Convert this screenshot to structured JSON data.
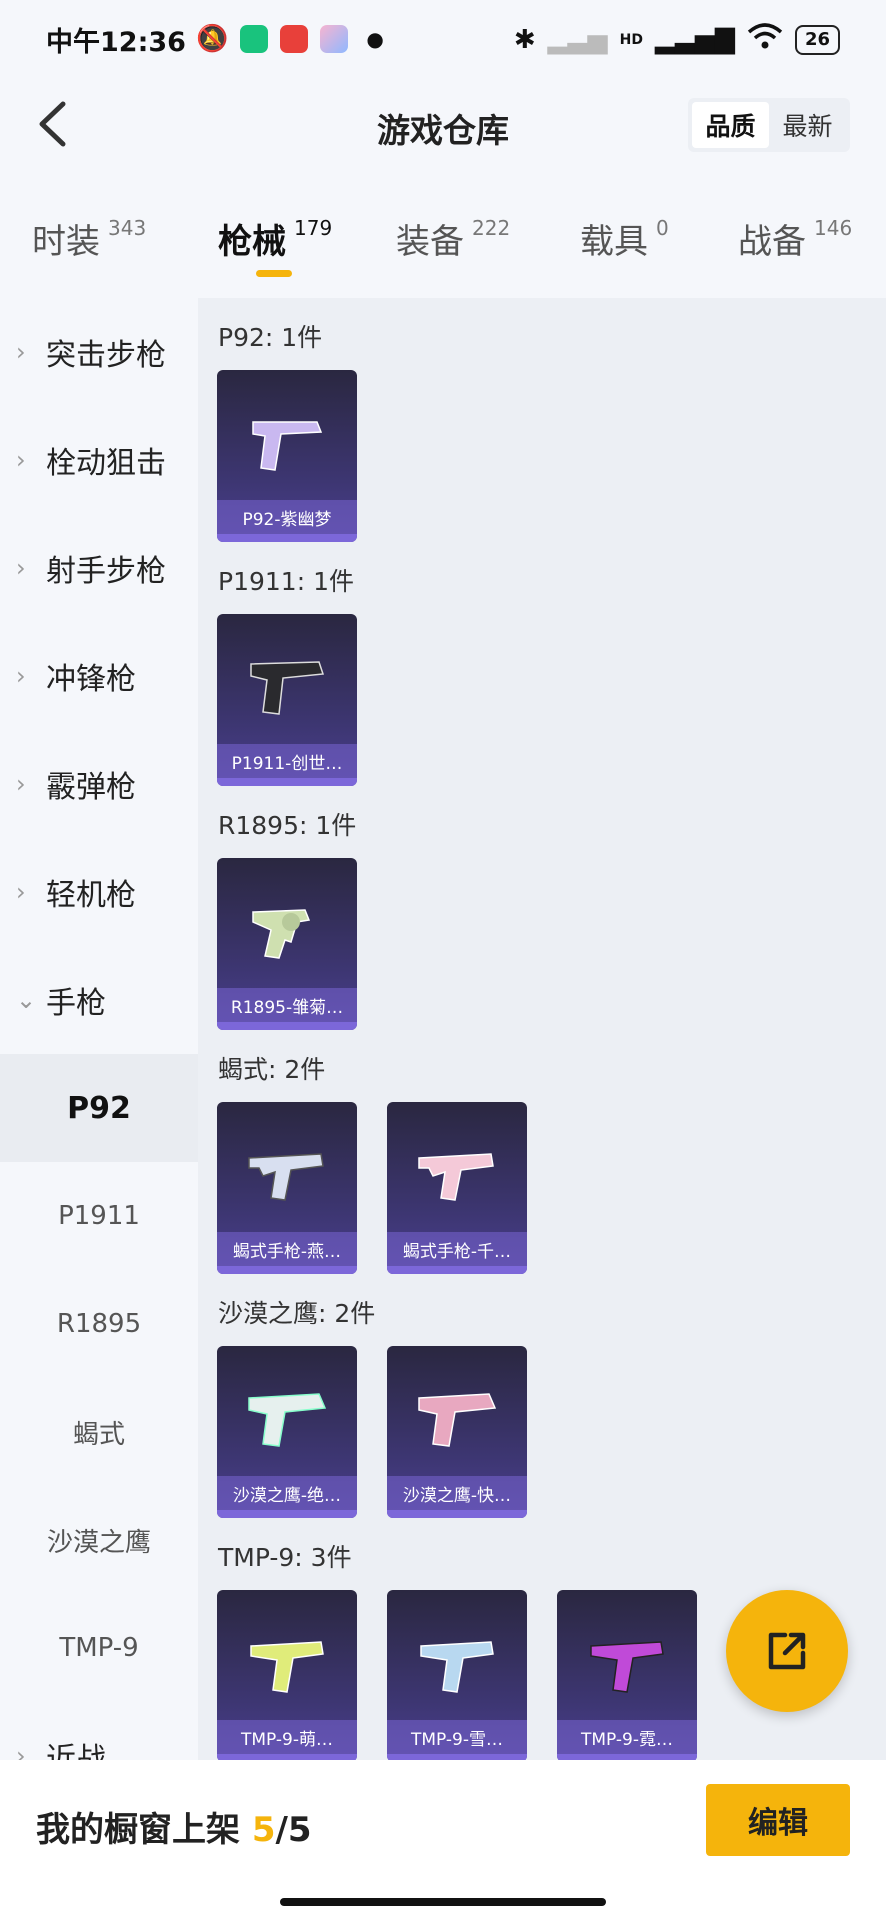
{
  "status_bar": {
    "time": "中午12:36",
    "battery": "26",
    "signal_label": "HD"
  },
  "header": {
    "title": "游戏仓库",
    "sort_options": [
      "品质",
      "最新"
    ],
    "active_sort": "品质"
  },
  "tabs": [
    {
      "label": "时装",
      "count": "343"
    },
    {
      "label": "枪械",
      "count": "179"
    },
    {
      "label": "装备",
      "count": "222"
    },
    {
      "label": "载具",
      "count": "0"
    },
    {
      "label": "战备",
      "count": "146"
    }
  ],
  "active_tab": "枪械",
  "sidebar": {
    "categories": [
      "突击步枪",
      "栓动狙击",
      "射手步枪",
      "冲锋枪",
      "霰弹枪",
      "轻机枪",
      "手枪"
    ],
    "expanded_category": "手枪",
    "sub_items": [
      "P92",
      "P1911",
      "R1895",
      "蝎式",
      "沙漠之鹰",
      "TMP-9"
    ],
    "active_sub_item": "P92",
    "partial_item": "近战"
  },
  "groups": [
    {
      "title": "P92: 1件",
      "items": [
        {
          "name": "P92-紫幽梦",
          "icon": "pistol-icon",
          "color": "#c9b8f0"
        }
      ]
    },
    {
      "title": "P1911: 1件",
      "items": [
        {
          "name": "P1911-创世…",
          "icon": "pistol-icon",
          "color": "#2a2a2e"
        }
      ]
    },
    {
      "title": "R1895: 1件",
      "items": [
        {
          "name": "R1895-雏菊…",
          "icon": "revolver-icon",
          "color": "#cfe0b0"
        }
      ]
    },
    {
      "title": "蝎式: 2件",
      "items": [
        {
          "name": "蝎式手枪-燕…",
          "icon": "smg-icon",
          "color": "#d8dff0"
        },
        {
          "name": "蝎式手枪-千…",
          "icon": "smg-icon",
          "color": "#f4c9d8"
        }
      ]
    },
    {
      "title": "沙漠之鹰: 2件",
      "items": [
        {
          "name": "沙漠之鹰-绝…",
          "icon": "pistol-icon",
          "color": "#e6f0ee"
        },
        {
          "name": "沙漠之鹰-快…",
          "icon": "pistol-icon",
          "color": "#e8a8c0"
        }
      ]
    },
    {
      "title": "TMP-9: 3件",
      "items": [
        {
          "name": "TMP-9-萌…",
          "icon": "smg-icon",
          "color": "#e0ec7a"
        },
        {
          "name": "TMP-9-雪…",
          "icon": "smg-icon",
          "color": "#b8d8f0"
        },
        {
          "name": "TMP-9-霓…",
          "icon": "smg-icon",
          "color": "#c04ad8"
        }
      ]
    }
  ],
  "bottom_bar": {
    "label": "我的橱窗上架",
    "count": "5",
    "total": "/5",
    "edit_label": "编辑"
  },
  "colors": {
    "accent": "#f5b40c",
    "card_bg": "#3d3672"
  }
}
